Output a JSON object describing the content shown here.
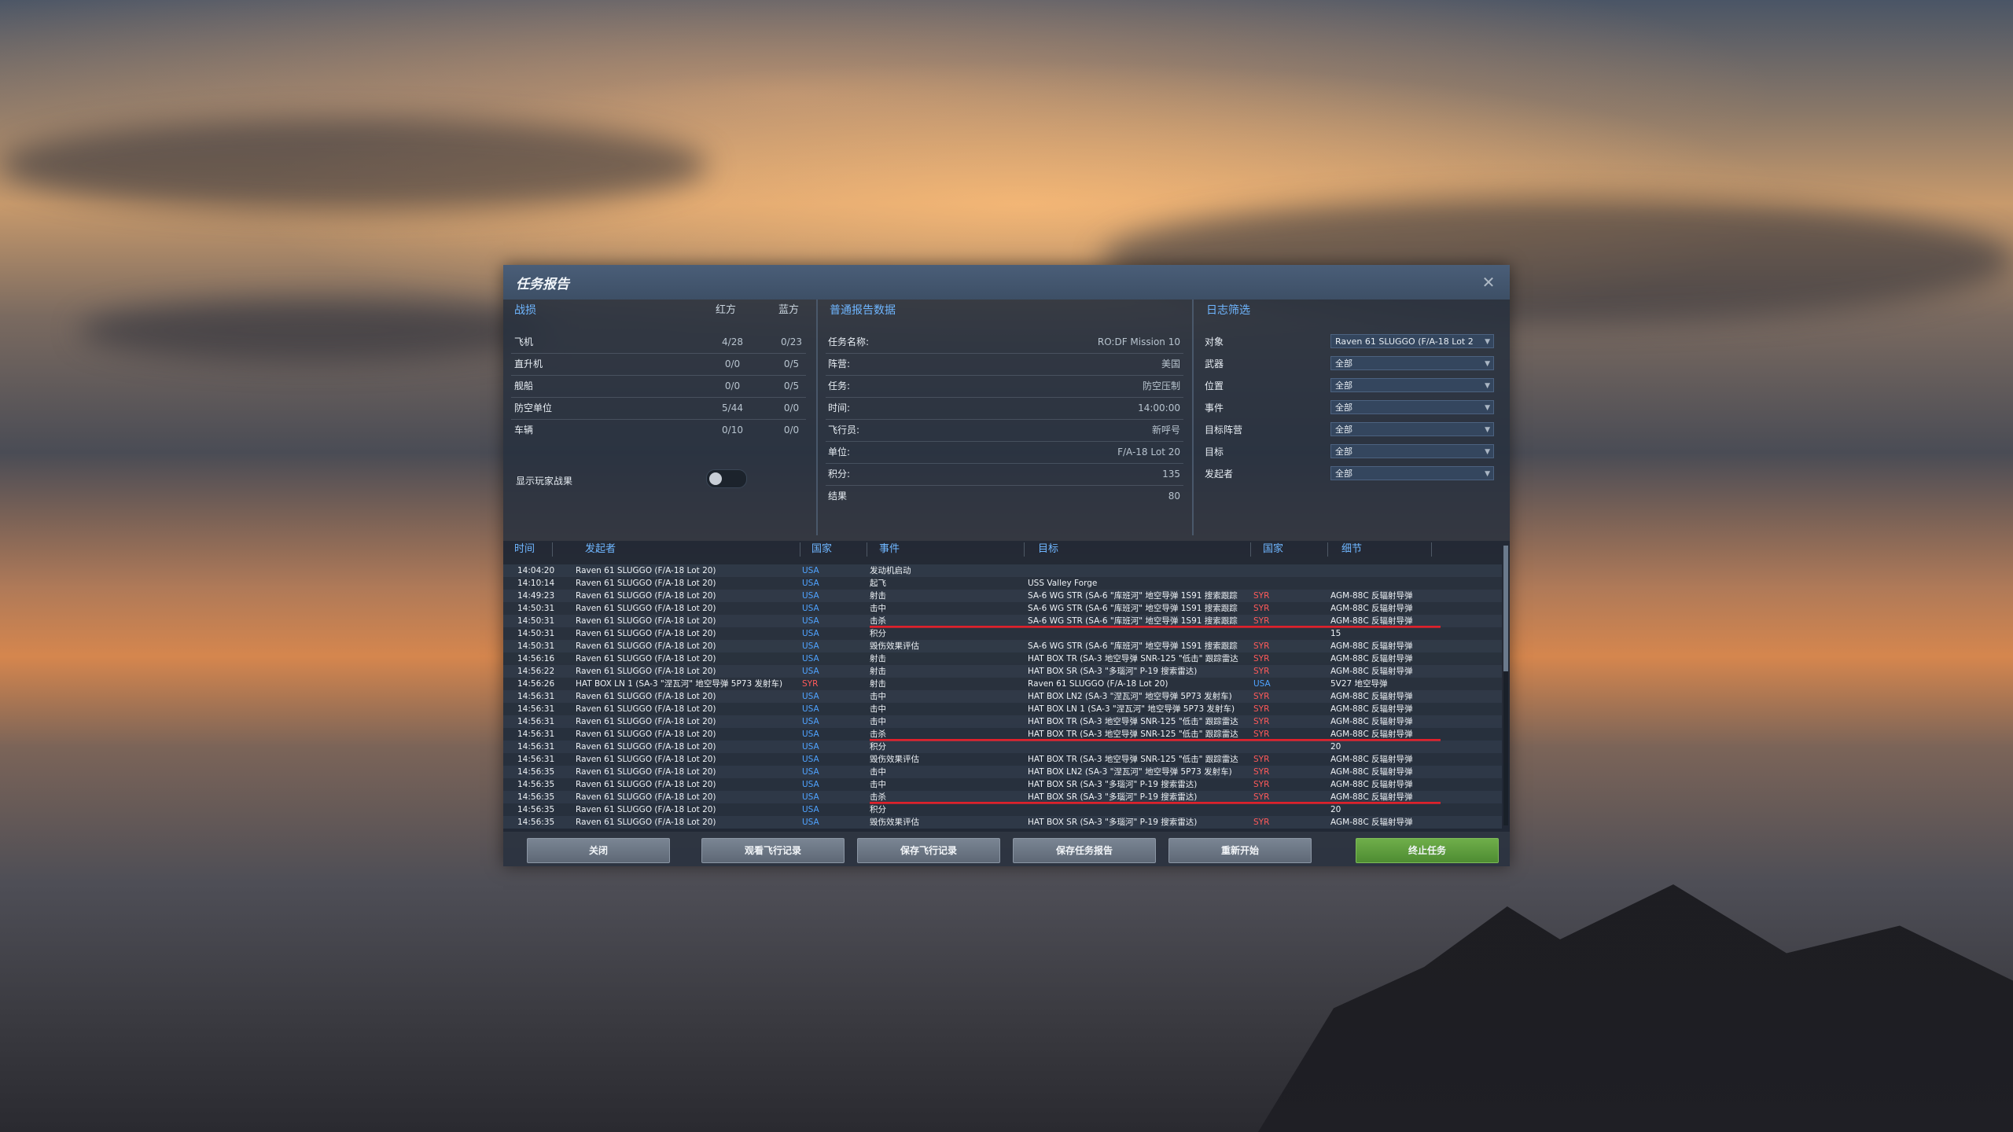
{
  "dialog": {
    "title": "任务报告"
  },
  "combat": {
    "header": "战损",
    "red": "红方",
    "blue": "蓝方",
    "rows": [
      {
        "label": "飞机",
        "red": "4/28",
        "blue": "0/23"
      },
      {
        "label": "直升机",
        "red": "0/0",
        "blue": "0/5"
      },
      {
        "label": "舰船",
        "red": "0/0",
        "blue": "0/5"
      },
      {
        "label": "防空单位",
        "red": "5/44",
        "blue": "0/0"
      },
      {
        "label": "车辆",
        "red": "0/10",
        "blue": "0/0"
      }
    ],
    "toggle_label": "显示玩家战果"
  },
  "general": {
    "header": "普通报告数据",
    "rows": [
      {
        "label": "任务名称:",
        "value": "RO:DF Mission 10"
      },
      {
        "label": "阵营:",
        "value": "美国"
      },
      {
        "label": "任务:",
        "value": "防空压制"
      },
      {
        "label": "时间:",
        "value": "14:00:00"
      },
      {
        "label": "飞行员:",
        "value": "新呼号"
      },
      {
        "label": "单位:",
        "value": "F/A-18 Lot 20"
      },
      {
        "label": "积分:",
        "value": "135"
      },
      {
        "label": "结果",
        "value": "80"
      }
    ]
  },
  "filters": {
    "header": "日志筛选",
    "rows": [
      {
        "label": "对象",
        "value": "Raven 61 SLUGGO (F/A-18 Lot 2"
      },
      {
        "label": "武器",
        "value": "全部"
      },
      {
        "label": "位置",
        "value": "全部"
      },
      {
        "label": "事件",
        "value": "全部"
      },
      {
        "label": "目标阵营",
        "value": "全部"
      },
      {
        "label": "目标",
        "value": "全部"
      },
      {
        "label": "发起者",
        "value": "全部"
      }
    ]
  },
  "log": {
    "headers": {
      "time": "时间",
      "initiator": "发起者",
      "country": "国家",
      "event": "事件",
      "target": "目标",
      "country2": "国家",
      "detail": "细节"
    },
    "rows": [
      {
        "t": "14:04:20",
        "i": "Raven 61 SLUGGO (F/A-18 Lot 20)",
        "n": "USA",
        "e": "发动机启动",
        "g": "",
        "n2": "",
        "d": ""
      },
      {
        "t": "14:10:14",
        "i": "Raven 61 SLUGGO (F/A-18 Lot 20)",
        "n": "USA",
        "e": "起飞",
        "g": "USS Valley Forge",
        "n2": "",
        "d": ""
      },
      {
        "t": "14:49:23",
        "i": "Raven 61 SLUGGO (F/A-18 Lot 20)",
        "n": "USA",
        "e": "射击",
        "g": "SA-6 WG STR (SA-6 \"库班河\" 地空导弹 1S91 搜索跟踪",
        "n2": "SYR",
        "d": "AGM-88C 反辐射导弹"
      },
      {
        "t": "14:50:31",
        "i": "Raven 61 SLUGGO (F/A-18 Lot 20)",
        "n": "USA",
        "e": "击中",
        "g": "SA-6 WG STR (SA-6 \"库班河\" 地空导弹 1S91 搜索跟踪",
        "n2": "SYR",
        "d": "AGM-88C 反辐射导弹"
      },
      {
        "t": "14:50:31",
        "i": "Raven 61 SLUGGO (F/A-18 Lot 20)",
        "n": "USA",
        "e": "击杀",
        "g": "SA-6 WG STR (SA-6 \"库班河\" 地空导弹 1S91 搜索跟踪",
        "n2": "SYR",
        "d": "AGM-88C 反辐射导弹",
        "k": true
      },
      {
        "t": "14:50:31",
        "i": "Raven 61 SLUGGO (F/A-18 Lot 20)",
        "n": "USA",
        "e": "积分",
        "g": "",
        "n2": "",
        "d": "15"
      },
      {
        "t": "14:50:31",
        "i": "Raven 61 SLUGGO (F/A-18 Lot 20)",
        "n": "USA",
        "e": "毁伤效果评估",
        "g": "SA-6 WG STR (SA-6 \"库班河\" 地空导弹 1S91 搜索跟踪",
        "n2": "SYR",
        "d": "AGM-88C 反辐射导弹"
      },
      {
        "t": "14:56:16",
        "i": "Raven 61 SLUGGO (F/A-18 Lot 20)",
        "n": "USA",
        "e": "射击",
        "g": "HAT BOX TR (SA-3 地空导弹 SNR-125 \"低击\" 跟踪雷达",
        "n2": "SYR",
        "d": "AGM-88C 反辐射导弹"
      },
      {
        "t": "14:56:22",
        "i": "Raven 61 SLUGGO (F/A-18 Lot 20)",
        "n": "USA",
        "e": "射击",
        "g": "HAT BOX SR (SA-3 \"多瑙河\" P-19 搜索雷达)",
        "n2": "SYR",
        "d": "AGM-88C 反辐射导弹"
      },
      {
        "t": "14:56:26",
        "i": "HAT BOX LN 1 (SA-3 \"涅瓦河\" 地空导弹 5P73 发射车)",
        "n": "SYR",
        "e": "射击",
        "g": "Raven 61 SLUGGO (F/A-18 Lot 20)",
        "n2": "USA",
        "d": "5V27 地空导弹"
      },
      {
        "t": "14:56:31",
        "i": "Raven 61 SLUGGO (F/A-18 Lot 20)",
        "n": "USA",
        "e": "击中",
        "g": "HAT BOX LN2 (SA-3 \"涅瓦河\" 地空导弹 5P73 发射车)",
        "n2": "SYR",
        "d": "AGM-88C 反辐射导弹"
      },
      {
        "t": "14:56:31",
        "i": "Raven 61 SLUGGO (F/A-18 Lot 20)",
        "n": "USA",
        "e": "击中",
        "g": "HAT BOX LN 1 (SA-3 \"涅瓦河\" 地空导弹 5P73 发射车)",
        "n2": "SYR",
        "d": "AGM-88C 反辐射导弹"
      },
      {
        "t": "14:56:31",
        "i": "Raven 61 SLUGGO (F/A-18 Lot 20)",
        "n": "USA",
        "e": "击中",
        "g": "HAT BOX TR (SA-3 地空导弹 SNR-125 \"低击\" 跟踪雷达",
        "n2": "SYR",
        "d": "AGM-88C 反辐射导弹"
      },
      {
        "t": "14:56:31",
        "i": "Raven 61 SLUGGO (F/A-18 Lot 20)",
        "n": "USA",
        "e": "击杀",
        "g": "HAT BOX TR (SA-3 地空导弹 SNR-125 \"低击\" 跟踪雷达",
        "n2": "SYR",
        "d": "AGM-88C 反辐射导弹",
        "k": true
      },
      {
        "t": "14:56:31",
        "i": "Raven 61 SLUGGO (F/A-18 Lot 20)",
        "n": "USA",
        "e": "积分",
        "g": "",
        "n2": "",
        "d": "20"
      },
      {
        "t": "14:56:31",
        "i": "Raven 61 SLUGGO (F/A-18 Lot 20)",
        "n": "USA",
        "e": "毁伤效果评估",
        "g": "HAT BOX TR (SA-3 地空导弹 SNR-125 \"低击\" 跟踪雷达",
        "n2": "SYR",
        "d": "AGM-88C 反辐射导弹"
      },
      {
        "t": "14:56:35",
        "i": "Raven 61 SLUGGO (F/A-18 Lot 20)",
        "n": "USA",
        "e": "击中",
        "g": "HAT BOX LN2 (SA-3 \"涅瓦河\" 地空导弹 5P73 发射车)",
        "n2": "SYR",
        "d": "AGM-88C 反辐射导弹"
      },
      {
        "t": "14:56:35",
        "i": "Raven 61 SLUGGO (F/A-18 Lot 20)",
        "n": "USA",
        "e": "击中",
        "g": "HAT BOX SR (SA-3 \"多瑙河\" P-19 搜索雷达)",
        "n2": "SYR",
        "d": "AGM-88C 反辐射导弹"
      },
      {
        "t": "14:56:35",
        "i": "Raven 61 SLUGGO (F/A-18 Lot 20)",
        "n": "USA",
        "e": "击杀",
        "g": "HAT BOX SR (SA-3 \"多瑙河\" P-19 搜索雷达)",
        "n2": "SYR",
        "d": "AGM-88C 反辐射导弹",
        "k": true
      },
      {
        "t": "14:56:35",
        "i": "Raven 61 SLUGGO (F/A-18 Lot 20)",
        "n": "USA",
        "e": "积分",
        "g": "",
        "n2": "",
        "d": "20"
      },
      {
        "t": "14:56:35",
        "i": "Raven 61 SLUGGO (F/A-18 Lot 20)",
        "n": "USA",
        "e": "毁伤效果评估",
        "g": "HAT BOX SR (SA-3 \"多瑙河\" P-19 搜索雷达)",
        "n2": "SYR",
        "d": "AGM-88C 反辐射导弹"
      }
    ]
  },
  "buttons": {
    "close": "关闭",
    "view_track": "观看飞行记录",
    "save_track": "保存飞行记录",
    "save_report": "保存任务报告",
    "restart": "重新开始",
    "end_mission": "终止任务"
  },
  "colors": {
    "usa": "#4fa3ff",
    "syr": "#ff5a5a",
    "accent": "#6fb6ff",
    "kill_marker": "#e0202a",
    "end_button": "#5a9a3c"
  }
}
